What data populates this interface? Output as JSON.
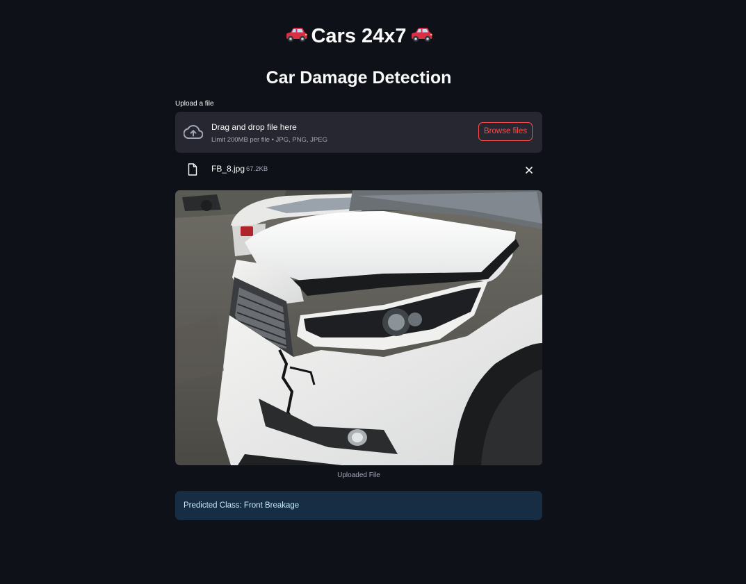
{
  "header": {
    "title": "Cars 24x7",
    "heading": "Car Damage Detection",
    "emoji": "car-emoji"
  },
  "uploader": {
    "label": "Upload a file",
    "drop_text": "Drag and drop file here",
    "limit_text": "Limit 200MB per file • JPG, PNG, JPEG",
    "browse_label": "Browse files",
    "icon": "cloud-upload-icon"
  },
  "uploaded_file": {
    "name": "FB_8.jpg",
    "size": "67.2KB",
    "file_icon": "file-icon",
    "remove_icon": "close-icon"
  },
  "image": {
    "caption": "Uploaded File"
  },
  "result": {
    "text": "Predicted Class: Front Breakage"
  },
  "colors": {
    "background": "#0e1117",
    "dropzone": "#262730",
    "accent": "#ff4b4b",
    "info_bg": "#172d43",
    "info_text": "#c7ebff"
  }
}
